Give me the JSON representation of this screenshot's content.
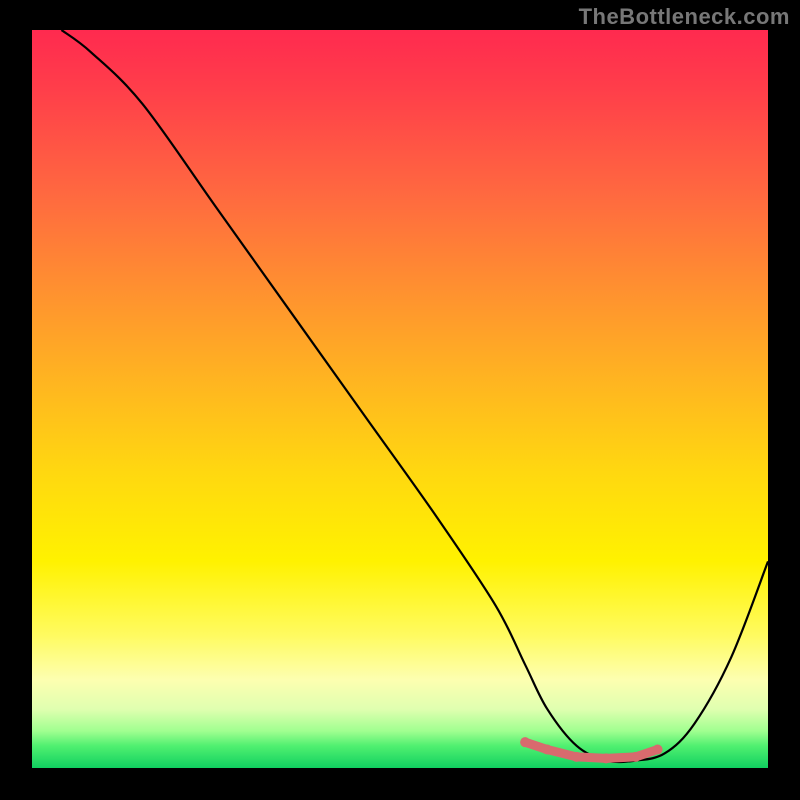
{
  "watermark": "TheBottleneck.com",
  "chart_data": {
    "type": "line",
    "title": "",
    "xlabel": "",
    "ylabel": "",
    "xlim": [
      0,
      100
    ],
    "ylim": [
      0,
      100
    ],
    "series": [
      {
        "name": "curve",
        "x": [
          4,
          8,
          15,
          25,
          35,
          45,
          55,
          63,
          67,
          70,
          74,
          78,
          82,
          86,
          90,
          95,
          100
        ],
        "values": [
          100,
          97,
          90,
          76,
          62,
          48,
          34,
          22,
          14,
          8,
          3,
          1,
          1,
          2,
          6,
          15,
          28
        ]
      }
    ],
    "markers": {
      "name": "flat-region",
      "x": [
        67,
        70,
        74,
        78,
        82,
        85
      ],
      "values": [
        3.5,
        2.5,
        1.5,
        1.3,
        1.5,
        2.5
      ],
      "color": "#d86a6e"
    }
  }
}
